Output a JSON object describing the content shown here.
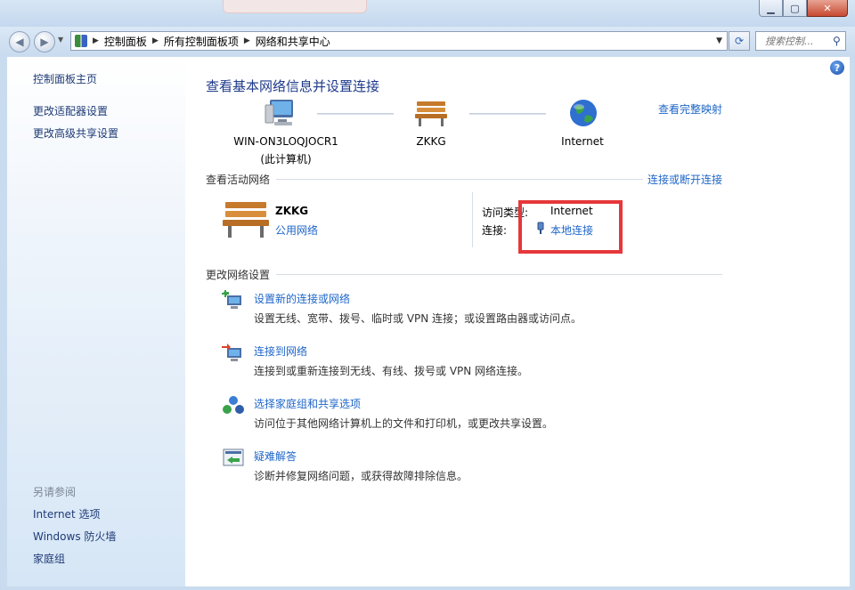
{
  "window": {
    "buttons": {
      "minimize": "▁",
      "maximize": "▢",
      "close": "✕"
    }
  },
  "navigation": {
    "breadcrumbs": [
      "控制面板",
      "所有控制面板项",
      "网络和共享中心"
    ],
    "search_placeholder": "搜索控制..."
  },
  "sidebar": {
    "top_links": [
      "控制面板主页",
      "更改适配器设置",
      "更改高级共享设置"
    ],
    "see_also_heading": "另请参阅",
    "see_also_links": [
      "Internet 选项",
      "Windows 防火墙",
      "家庭组"
    ]
  },
  "main": {
    "title": "查看基本网络信息并设置连接",
    "view_full_map": "查看完整映射",
    "map": {
      "computer_name": "WIN-ON3LOQJOCR1",
      "computer_sub": "(此计算机)",
      "network_name": "ZKKG",
      "internet_label": "Internet"
    },
    "active": {
      "heading": "查看活动网络",
      "connect_disconnect": "连接或断开连接",
      "network_name": "ZKKG",
      "network_type": "公用网络",
      "access_label": "访问类型:",
      "access_value": "Internet",
      "connection_label": "连接:",
      "connection_value": "本地连接"
    },
    "change": {
      "heading": "更改网络设置",
      "items": [
        {
          "title": "设置新的连接或网络",
          "desc": "设置无线、宽带、拨号、临时或 VPN 连接；或设置路由器或访问点。"
        },
        {
          "title": "连接到网络",
          "desc": "连接到或重新连接到无线、有线、拨号或 VPN 网络连接。"
        },
        {
          "title": "选择家庭组和共享选项",
          "desc": "访问位于其他网络计算机上的文件和打印机，或更改共享设置。"
        },
        {
          "title": "疑难解答",
          "desc": "诊断并修复网络问题，或获得故障排除信息。"
        }
      ]
    }
  },
  "colors": {
    "link": "#1e66c8",
    "title": "#1e3a8a",
    "highlight": "#e6373a"
  }
}
